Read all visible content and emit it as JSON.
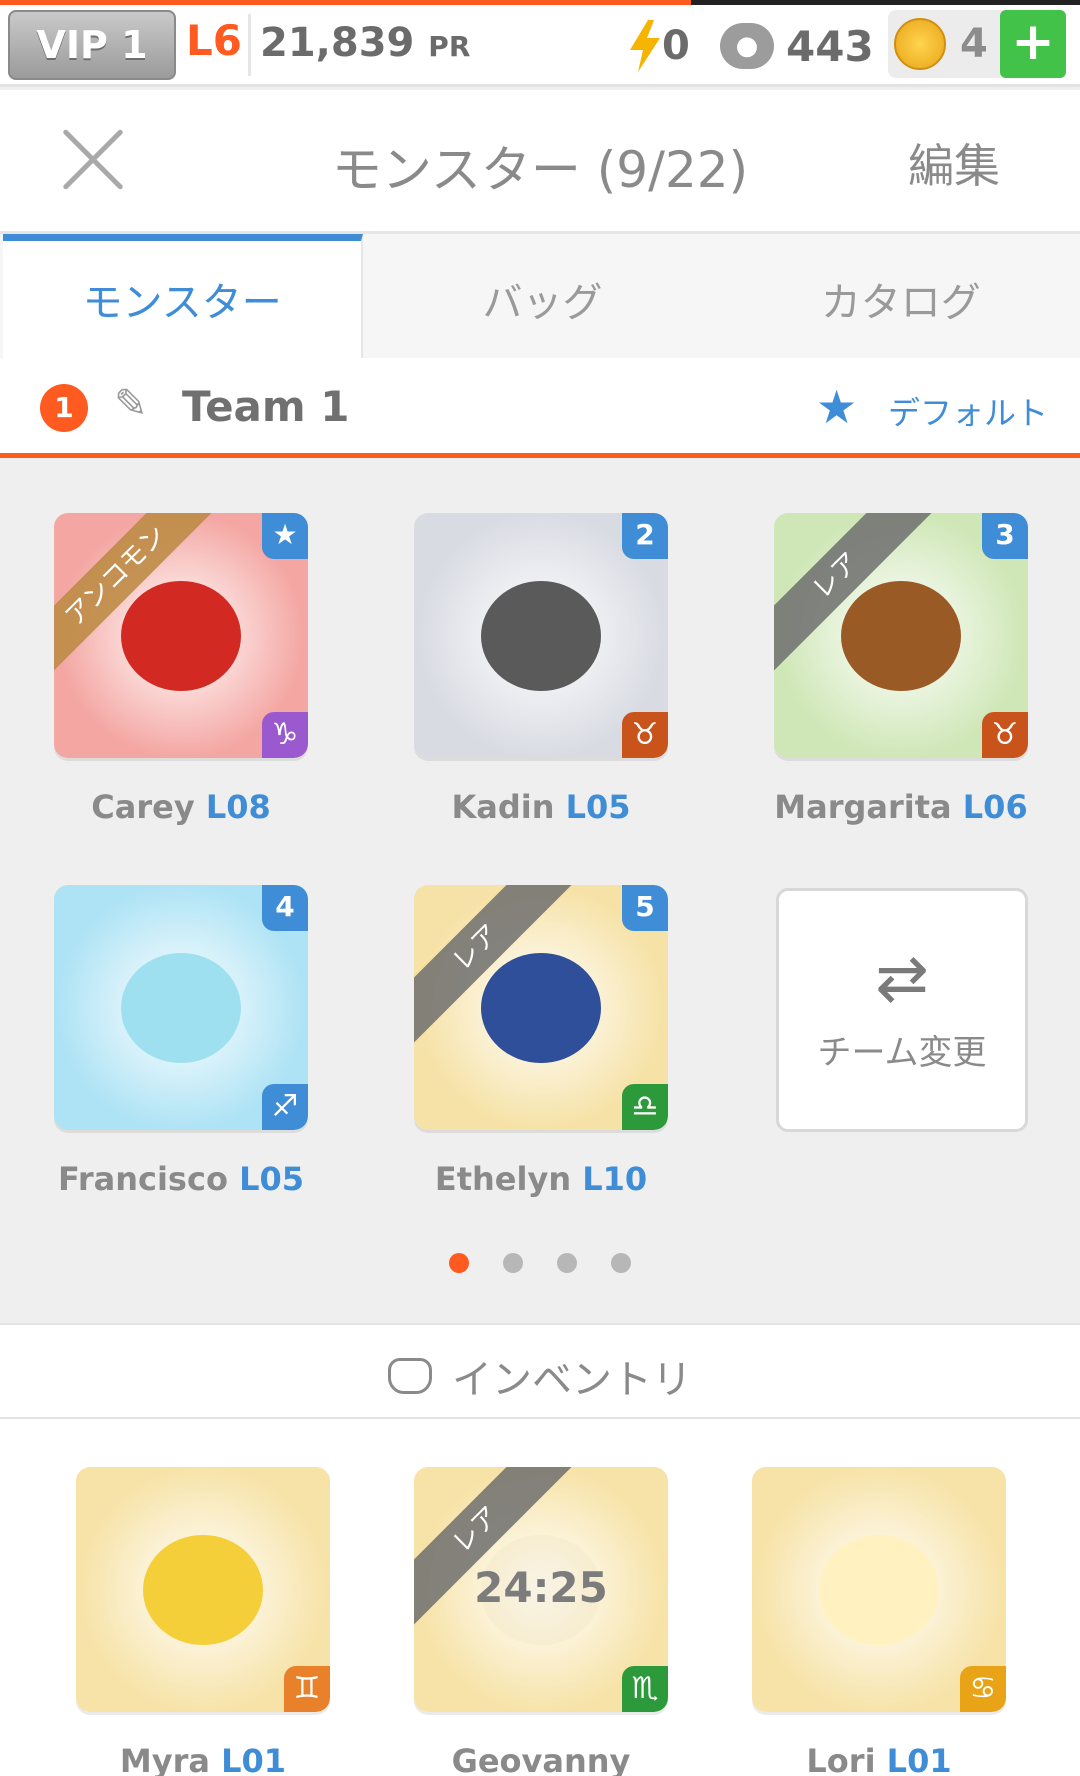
{
  "status": {
    "vip": "VIP 1",
    "level": "L6",
    "pr_value": "21,839",
    "pr_unit": "PR",
    "energy": "0",
    "paws": "443",
    "coins": "4",
    "add": "+",
    "progress_fraction": 0.64
  },
  "header": {
    "title": "モンスター (9/22)",
    "edit": "編集"
  },
  "tabs": [
    {
      "label": "モンスター",
      "active": true
    },
    {
      "label": "バッグ",
      "active": false
    },
    {
      "label": "カタログ",
      "active": false
    }
  ],
  "team": {
    "number": "1",
    "name": "Team 1",
    "default_label": "デフォルト"
  },
  "team_monsters": [
    {
      "name": "Carey",
      "level": "L08",
      "badge": "★",
      "ribbon": "アンコモン",
      "sign": "♑",
      "bg": "#f4a6a2",
      "badge_color": "#3e8dd6",
      "sign_color": "#9b59d0",
      "creature_color": "#d22a22"
    },
    {
      "name": "Kadin",
      "level": "L05",
      "badge": "2",
      "ribbon": "",
      "sign": "♉",
      "bg": "#d9dbe3",
      "badge_color": "#3e8dd6",
      "sign_color": "#c8541c",
      "creature_color": "#5a5a5a"
    },
    {
      "name": "Margarita",
      "level": "L06",
      "badge": "3",
      "ribbon": "レア",
      "sign": "♉",
      "bg": "#cfe7b7",
      "badge_color": "#3e8dd6",
      "sign_color": "#c8541c",
      "creature_color": "#9a5a26"
    },
    {
      "name": "Francisco",
      "level": "L05",
      "badge": "4",
      "ribbon": "",
      "sign": "♐",
      "bg": "#aee3f5",
      "badge_color": "#3e8dd6",
      "sign_color": "#3e8dd6",
      "creature_color": "#9fe0f0"
    },
    {
      "name": "Ethelyn",
      "level": "L10",
      "badge": "5",
      "ribbon": "レア",
      "sign": "♎",
      "bg": "#f6e2a6",
      "badge_color": "#3e8dd6",
      "sign_color": "#2c9a3a",
      "creature_color": "#2f4f9a"
    }
  ],
  "swap": {
    "arrows": "⇄",
    "label": "チーム変更"
  },
  "pager": {
    "pages": 4,
    "current": 0
  },
  "inventory": {
    "title": "インベントリ",
    "items": [
      {
        "name": "Myra",
        "level": "L01",
        "ribbon": "",
        "sign": "♊",
        "bg": "#f7e3a8",
        "sign_color": "#e8812a",
        "creature_color": "#f5cf3a",
        "timer": ""
      },
      {
        "name": "Geovanny",
        "level": "",
        "ribbon": "レア",
        "sign": "♏",
        "bg": "#f7e3a8",
        "sign_color": "#2c9a3a",
        "creature_color": "#f2e7c8",
        "timer": "24:25"
      },
      {
        "name": "Lori",
        "level": "L01",
        "ribbon": "",
        "sign": "♋",
        "bg": "#f7e3a8",
        "sign_color": "#e8a317",
        "creature_color": "#fff2c0",
        "timer": ""
      }
    ]
  }
}
